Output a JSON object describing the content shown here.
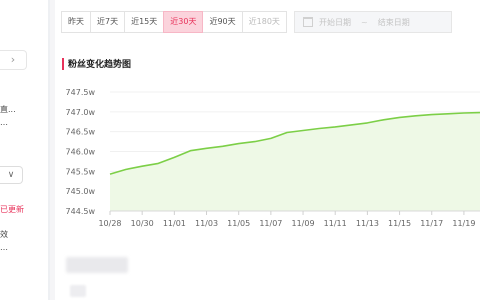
{
  "sidebar": {
    "chevron_icon": "›",
    "text1": "直...",
    "text2": "…",
    "select_icon": "∨",
    "update_label": "已更新",
    "text3": "效",
    "text4": "…"
  },
  "filters": {
    "tabs": [
      {
        "label": "昨天",
        "state": "normal"
      },
      {
        "label": "近7天",
        "state": "normal"
      },
      {
        "label": "近15天",
        "state": "normal"
      },
      {
        "label": "近30天",
        "state": "active"
      },
      {
        "label": "近90天",
        "state": "normal"
      },
      {
        "label": "近180天",
        "state": "disabled"
      }
    ],
    "start_placeholder": "开始日期",
    "end_placeholder": "结束日期",
    "separator": "~"
  },
  "section": {
    "title": "粉丝变化趋势图"
  },
  "colors": {
    "accent": "#e8335b",
    "line": "#7ccf47",
    "fill": "#eef9e6"
  },
  "chart_data": {
    "type": "area",
    "title": "粉丝变化趋势图",
    "y_ticks": [
      "744.5w",
      "745.0w",
      "745.5w",
      "746.0w",
      "746.5w",
      "747.0w",
      "747.5w"
    ],
    "ylim": [
      744.5,
      747.5
    ],
    "x_ticks": [
      "10/28",
      "10/30",
      "11/01",
      "11/03",
      "11/05",
      "11/07",
      "11/09",
      "11/11",
      "11/13",
      "11/15",
      "11/17",
      "11/19"
    ],
    "x": [
      "10/28",
      "10/29",
      "10/30",
      "10/31",
      "11/01",
      "11/02",
      "11/03",
      "11/04",
      "11/05",
      "11/06",
      "11/07",
      "11/08",
      "11/09",
      "11/10",
      "11/11",
      "11/12",
      "11/13",
      "11/14",
      "11/15",
      "11/16",
      "11/17",
      "11/18",
      "11/19",
      "11/20"
    ],
    "values": [
      745.43,
      745.55,
      745.63,
      745.7,
      745.85,
      746.02,
      746.08,
      746.13,
      746.2,
      746.25,
      746.33,
      746.48,
      746.53,
      746.58,
      746.62,
      746.67,
      746.72,
      746.8,
      746.86,
      746.9,
      746.93,
      746.95,
      746.97,
      746.98
    ],
    "grid": "horizontal",
    "legend": "none"
  }
}
